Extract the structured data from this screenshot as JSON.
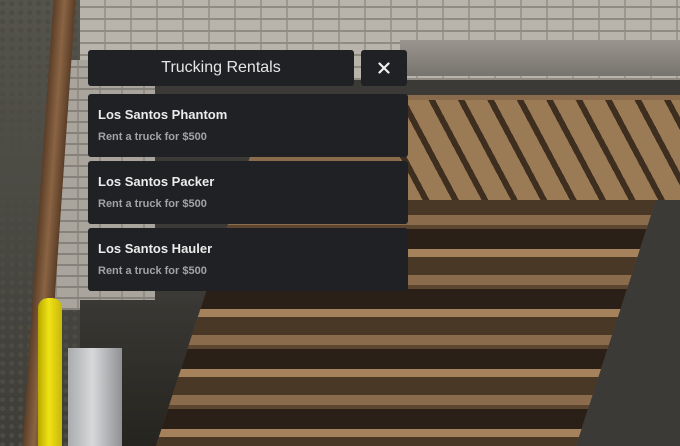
{
  "menu": {
    "title": "Trucking Rentals",
    "close_icon": "close-icon",
    "items": [
      {
        "title": "Los Santos Phantom",
        "description": "Rent a truck for $500"
      },
      {
        "title": "Los Santos Packer",
        "description": "Rent a truck for $500"
      },
      {
        "title": "Los Santos Hauler",
        "description": "Rent a truck for $500"
      }
    ]
  },
  "colors": {
    "panel_background": "#202124",
    "title_text": "#e6e6e6",
    "item_title_text": "#ececec",
    "item_description_text": "#a3a3a6"
  }
}
